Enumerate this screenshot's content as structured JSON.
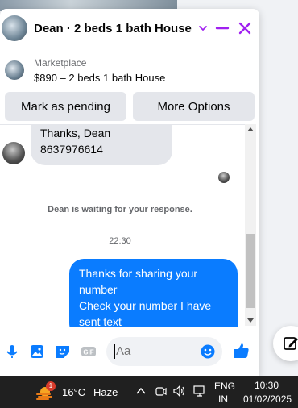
{
  "chat": {
    "title": "Dean · 2 beds 1 bath House",
    "listing": {
      "source": "Marketplace",
      "title": "$890 – 2 beds 1 bath House"
    },
    "actions": {
      "pending": "Mark as pending",
      "more": "More Options"
    },
    "messages": {
      "incoming_line1": "Thanks, Dean",
      "incoming_line2": "8637976614",
      "waiting_notice": "Dean is waiting for your response.",
      "timestamp": "22:30",
      "outgoing_line1": "Thanks for sharing your number",
      "outgoing_line2": "Check your number I have sent text"
    },
    "composer": {
      "placeholder": "Aa"
    },
    "accent_color": "#0a7cff",
    "header_icon_color": "#a020f0"
  },
  "taskbar": {
    "weather_badge": "1",
    "temperature": "16°C",
    "condition": "Haze",
    "lang_line1": "ENG",
    "lang_line2": "IN",
    "clock_time": "10:30",
    "clock_date": "01/02/2025"
  }
}
